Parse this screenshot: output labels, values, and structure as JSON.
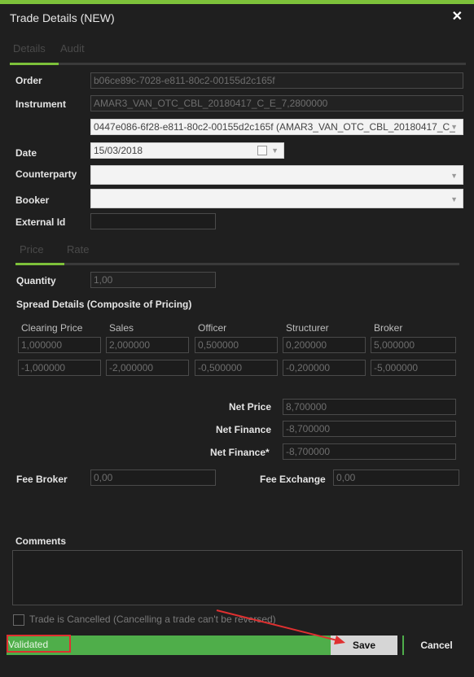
{
  "window": {
    "title": "Trade Details (NEW)",
    "close_glyph": "✕"
  },
  "tabs": {
    "details": "Details",
    "audit": "Audit"
  },
  "fields": {
    "order_label": "Order",
    "order_value": "b06ce89c-7028-e811-80c2-00155d2c165f",
    "instrument_label": "Instrument",
    "instrument_value": "AMAR3_VAN_OTC_CBL_20180417_C_E_7,2800000",
    "instrument_select": "0447e086-6f28-e811-80c2-00155d2c165f (AMAR3_VAN_OTC_CBL_20180417_C_",
    "date_label": "Date",
    "date_value": "15/03/2018",
    "counterparty_label": "Counterparty",
    "counterparty_value": "",
    "booker_label": "Booker",
    "booker_value": "",
    "external_id_label": "External Id",
    "external_id_value": ""
  },
  "subtabs": {
    "price": "Price",
    "rate": "Rate"
  },
  "pricing": {
    "quantity_label": "Quantity",
    "quantity_value": "1,00",
    "spread_title": "Spread Details (Composite of Pricing)",
    "columns": [
      "Clearing Price",
      "Sales",
      "Officer",
      "Structurer",
      "Broker"
    ],
    "row1": [
      "1,000000",
      "2,000000",
      "0,500000",
      "0,200000",
      "5,000000"
    ],
    "row2": [
      "-1,000000",
      "-2,000000",
      "-0,500000",
      "-0,200000",
      "-5,000000"
    ],
    "net_price_label": "Net Price",
    "net_price_value": "8,700000",
    "net_finance_label": "Net Finance",
    "net_finance_value": "-8,700000",
    "net_finance2_label": "Net Finance*",
    "net_finance2_value": "-8,700000",
    "fee_broker_label": "Fee Broker",
    "fee_broker_value": "0,00",
    "fee_exchange_label": "Fee Exchange",
    "fee_exchange_value": "0,00"
  },
  "comments": {
    "label": "Comments",
    "value": ""
  },
  "cancelled": {
    "label": "Trade is Cancelled (Cancelling a trade can't be reversed)",
    "checked": false
  },
  "footer": {
    "status": "Validated",
    "save": "Save",
    "cancel": "Cancel"
  },
  "colors": {
    "accent": "#7dc13a",
    "status_bar": "#4fae4a",
    "highlight": "#e03030"
  }
}
